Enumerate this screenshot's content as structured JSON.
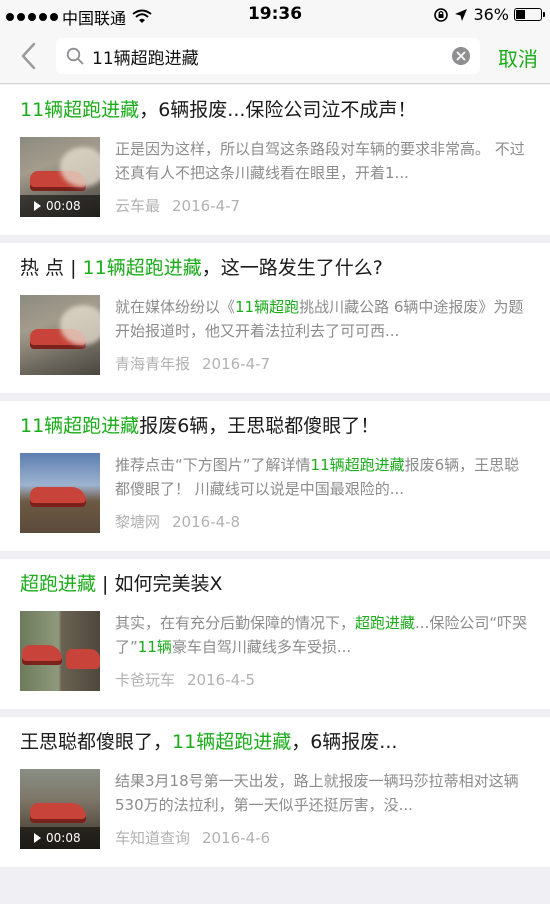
{
  "status_bar": {
    "carrier": "中国联通",
    "time": "19:36",
    "battery": "36%",
    "battery_level": 0.36
  },
  "search": {
    "back_icon": "chevron-left-icon",
    "search_icon": "search-icon",
    "query": "11辆超跑进藏",
    "clear_icon": "clear-icon",
    "cancel_label": "取消",
    "accent_color": "#1aad19"
  },
  "results": [
    {
      "title_parts": [
        {
          "text": "11辆超跑进藏",
          "hl": true
        },
        {
          "text": "，6辆报废...保险公司泣不成声！",
          "hl": false
        }
      ],
      "snippet_parts": [
        {
          "text": "正是因为这样，所以自驾这条路段对车辆的要求非常高。 不过还真有人不把这条川藏线看在眼里，开着1...",
          "hl": false
        }
      ],
      "source": "云车最",
      "date": "2016-4-7",
      "video_duration": "00:08",
      "thumb": "dust"
    },
    {
      "title_parts": [
        {
          "text": "热 点 | ",
          "hl": false
        },
        {
          "text": "11辆超跑进藏",
          "hl": true
        },
        {
          "text": "，这一路发生了什么?",
          "hl": false
        }
      ],
      "snippet_parts": [
        {
          "text": "就在媒体纷纷以《",
          "hl": false
        },
        {
          "text": "11辆超跑",
          "hl": true
        },
        {
          "text": "挑战川藏公路 6辆中途报废》为题开始报道时，他又开着法拉利去了可可西...",
          "hl": false
        }
      ],
      "source": "青海青年报",
      "date": "2016-4-7",
      "video_duration": "",
      "thumb": "dust"
    },
    {
      "title_parts": [
        {
          "text": "11辆超跑进藏",
          "hl": true
        },
        {
          "text": "报废6辆，王思聪都傻眼了！",
          "hl": false
        }
      ],
      "snippet_parts": [
        {
          "text": "推荐点击“下方图片”了解详情",
          "hl": false
        },
        {
          "text": "11辆超跑进藏",
          "hl": true
        },
        {
          "text": "报废6辆，王思聪都傻眼了！ 川藏线可以说是中国最艰险的...",
          "hl": false
        }
      ],
      "source": "黎塘网",
      "date": "2016-4-8",
      "video_duration": "",
      "thumb": "sky"
    },
    {
      "title_parts": [
        {
          "text": "超跑进藏",
          "hl": true
        },
        {
          "text": " | 如何完美装X",
          "hl": false
        }
      ],
      "snippet_parts": [
        {
          "text": "其实，在有充分后勤保障的情况下，",
          "hl": false
        },
        {
          "text": "超跑进藏",
          "hl": true
        },
        {
          "text": "...保险公司“吓哭了”",
          "hl": false
        },
        {
          "text": "11辆",
          "hl": true
        },
        {
          "text": "豪车自驾川藏线多车受损...",
          "hl": false
        }
      ],
      "source": "卡爸玩车",
      "date": "2016-4-5",
      "video_duration": "",
      "thumb": "split"
    },
    {
      "title_parts": [
        {
          "text": "王思聪都傻眼了，",
          "hl": false
        },
        {
          "text": "11辆超跑进藏",
          "hl": true
        },
        {
          "text": "，6辆报废...",
          "hl": false
        }
      ],
      "snippet_parts": [
        {
          "text": "结果3月18号第一天出发，路上就报废一辆玛莎拉蒂相对这辆530万的法拉利，第一天似乎还挺厉害，没...",
          "hl": false
        }
      ],
      "source": "车知道查询",
      "date": "2016-4-6",
      "video_duration": "00:08",
      "thumb": "grass"
    }
  ]
}
